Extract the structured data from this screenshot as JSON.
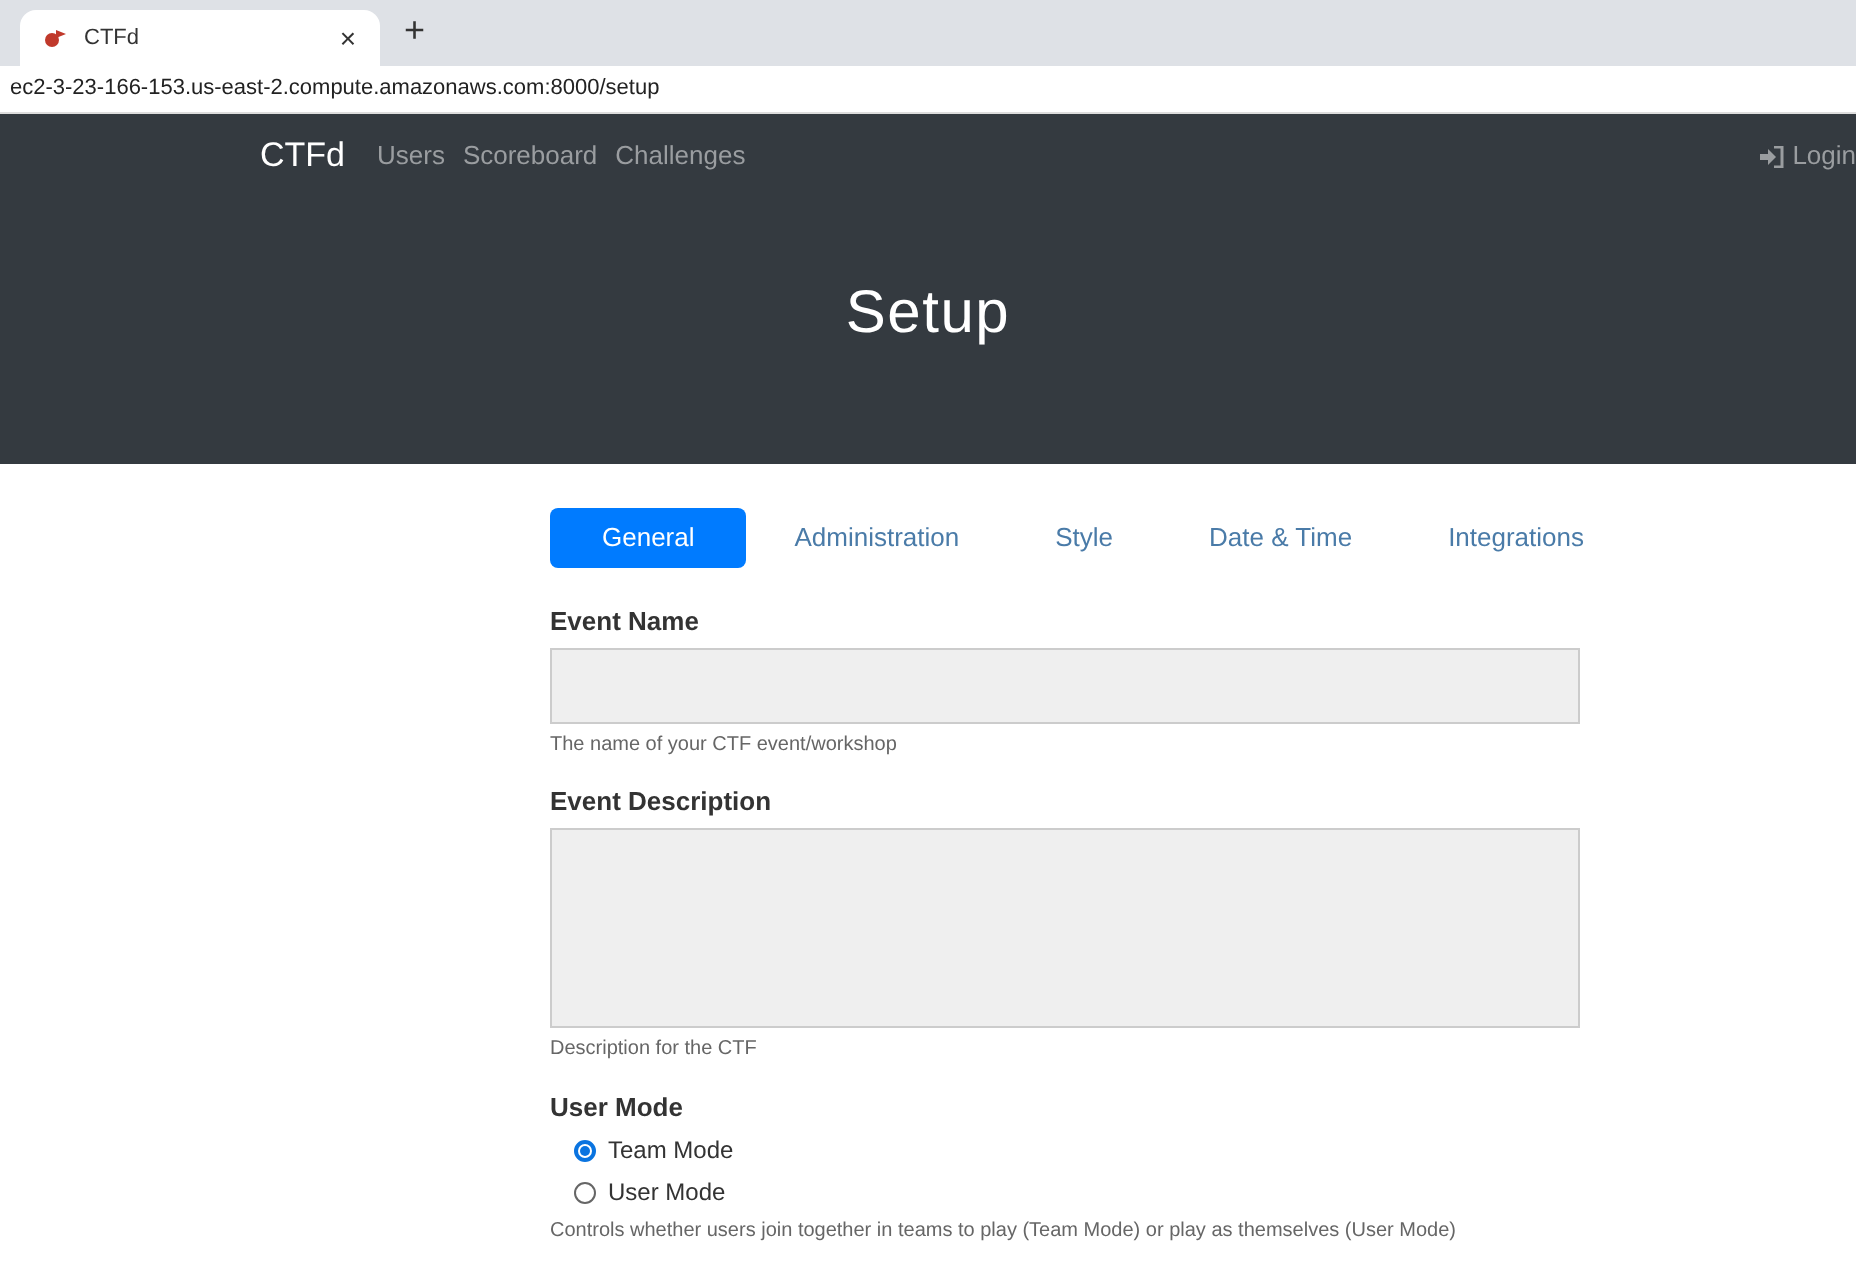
{
  "browser": {
    "tab": {
      "title": "CTFd",
      "close": "×"
    },
    "new_tab": "+",
    "url": "ec2-3-23-166-153.us-east-2.compute.amazonaws.com:8000/setup"
  },
  "navbar": {
    "brand": "CTFd",
    "links": [
      "Users",
      "Scoreboard",
      "Challenges"
    ],
    "login": "Login"
  },
  "title": "Setup",
  "tabs": [
    {
      "label": "General",
      "selected": true
    },
    {
      "label": "Administration",
      "selected": false
    },
    {
      "label": "Style",
      "selected": false
    },
    {
      "label": "Date & Time",
      "selected": false
    },
    {
      "label": "Integrations",
      "selected": false
    }
  ],
  "form": {
    "event_name": {
      "label": "Event Name",
      "help": "The name of your CTF event/workshop"
    },
    "event_description": {
      "label": "Event Description",
      "help": "Description for the CTF"
    },
    "user_mode": {
      "label": "User Mode",
      "options": [
        {
          "label": "Team Mode",
          "selected": true
        },
        {
          "label": "User Mode",
          "selected": false
        }
      ],
      "help": "Controls whether users join together in teams to play (Team Mode) or play as themselves (User Mode)"
    }
  }
}
